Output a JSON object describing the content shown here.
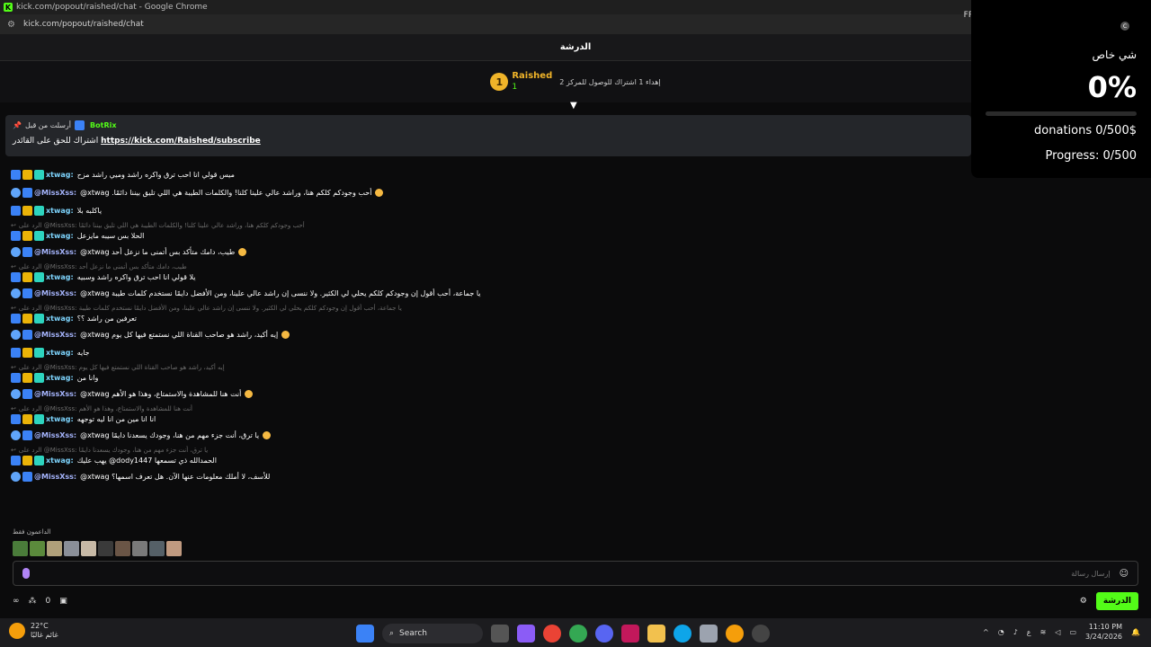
{
  "window": {
    "title": "kick.com/popout/raished/chat - Google Chrome",
    "url": "kick.com/popout/raished/chat",
    "fps_label": "FPS"
  },
  "chat": {
    "header_title": "الدرشة"
  },
  "goal": {
    "rank": "1",
    "streamer": "Raished",
    "count": "1",
    "text": "إهداء 1 اشتراك للوصول للمركز 2"
  },
  "pinned": {
    "pinned_by": "أرسلت من قبل",
    "bot_name": "BotRix",
    "text": "اشتراك للحق على القائدر",
    "link": "https://kick.com/Raished/subscribe"
  },
  "messages": [
    {
      "user": "xtwag:",
      "text": "ميس قولي انا احب ترق واكره راشد وميي راشد مزح",
      "reply": "",
      "style": "xt"
    },
    {
      "user": "@MissXss:",
      "text": "@xtwag .أحب وجودكم كلكم هنا، وراشد عالي علينا كلنا! والكلمات الطيبة هي اللي تليق بيننا دائمًا",
      "reply": "",
      "style": "miss",
      "emoji": true
    },
    {
      "user": "xtwag:",
      "text": "ياكلبه بلا",
      "reply": "",
      "style": "xt"
    },
    {
      "user": "xtwag:",
      "text": "الحلا بس سيبه مايزعل",
      "reply": "الرد على @MissXss: أحب وجودكم كلكم هنا، وراشد عالي علينا كلنا! والكلمات الطيبة هي اللي تليق بيننا دائمًا",
      "style": "xt"
    },
    {
      "user": "@MissXss:",
      "text": "@xtwag طيب، دامك متأكد بس أتمنى ما نزعل أحد",
      "reply": "",
      "style": "miss",
      "emoji": true
    },
    {
      "user": "xtwag:",
      "text": "يلا قولي انا احب ترق واكره راشد وسبيه",
      "reply": "الرد على @MissXss: طيب، دامك متأكد بس أتمنى ما نزعل أحد",
      "style": "xt"
    },
    {
      "user": "@MissXss:",
      "text": "@xtwag يا جماعة، أحب أقول إن وجودكم كلكم يحلي لي الكثير. ولا ننسى إن راشد عالي علينا، ومن الأفضل دايمًا نستخدم كلمات طيبة",
      "reply": "",
      "style": "miss"
    },
    {
      "user": "xtwag:",
      "text": "تعرفين من راشد ؟؟",
      "reply": "الرد على @MissXss: يا جماعة، أحب أقول إن وجودكم كلكم يحلي لي الكثير. ولا ننسى إن راشد عالي علينا، ومن الأفضل دايمًا نستخدم كلمات طيبة",
      "style": "xt"
    },
    {
      "user": "@MissXss:",
      "text": "@xtwag إيه أكيد، راشد هو صاحب القناة اللي نستمتع فيها كل يوم",
      "reply": "",
      "style": "miss",
      "emoji": true
    },
    {
      "user": "xtwag:",
      "text": "جايه",
      "reply": "",
      "style": "xt"
    },
    {
      "user": "xtwag:",
      "text": "وانا من",
      "reply": "الرد على @MissXss: إيه أكيد، راشد هو صاحب القناة اللي نستمتع فيها كل يوم",
      "style": "xt"
    },
    {
      "user": "@MissXss:",
      "text": "@xtwag أنت هنا للمشاهدة والاستمتاع، وهذا هو الأهم",
      "reply": "",
      "style": "miss",
      "emoji": true
    },
    {
      "user": "xtwag:",
      "text": "انا انا مين من انا ليه توجهه",
      "reply": "الرد على @MissXss: أنت هنا للمشاهدة والاستمتاع، وهذا هو الأهم",
      "style": "xt"
    },
    {
      "user": "@MissXss:",
      "text": "@xtwag يا ترق، أنت جزء مهم من هنا، وجودك يسعدنا دايمًا",
      "reply": "",
      "style": "miss",
      "emoji": true
    },
    {
      "user": "xtwag:",
      "text": "يهب عليك @dody1447 الحمدالله ذي تسمعها",
      "reply": "الرد على @MissXss: يا ترق، أنت جزء مهم من هنا، وجودك يسعدنا دايمًا",
      "style": "xt"
    },
    {
      "user": "@MissXss:",
      "text": "@xtwag للأسف، لا أملك معلومات عنها الآن. هل تعرف اسمها؟",
      "reply": "",
      "style": "miss"
    }
  ],
  "supporters": {
    "label": "الداعمون فقط"
  },
  "input": {
    "placeholder": "إرسال رسالة"
  },
  "footer": {
    "count": "0",
    "send_label": "الدرشة"
  },
  "overlay": {
    "icon_letter": "C",
    "title": "شي خاص",
    "percent": "0%",
    "progress_fraction": 0,
    "donations": "donations 0/500$",
    "progress": "Progress: 0/500"
  },
  "taskbar": {
    "temp": "22°C",
    "weather": "غائم غالبًا",
    "search": "Search",
    "lang": "ع",
    "time": "11:10 PM",
    "date": "3/24/2026"
  },
  "colors": {
    "accent": "#53fc18",
    "gold": "#f0b429"
  }
}
